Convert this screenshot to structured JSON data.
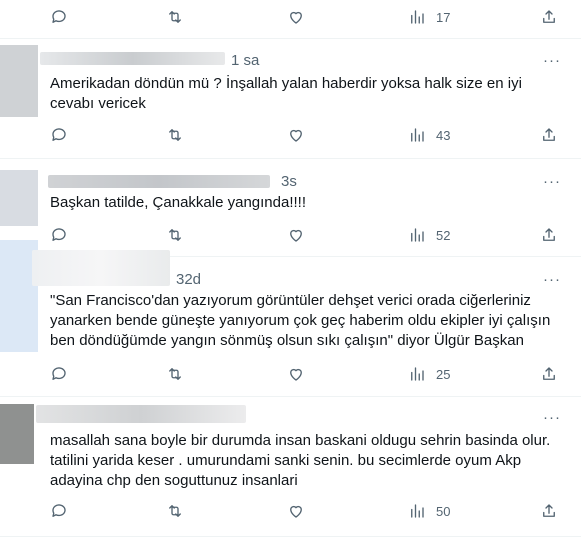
{
  "tweets": [
    {
      "time": "",
      "text": "",
      "views": "17"
    },
    {
      "time": "1 sa",
      "text": "Amerikadan döndün mü ? İnşallah yalan haberdir yoksa halk size en iyi\ncevabı vericek",
      "views": "43"
    },
    {
      "time": "3s",
      "text": "Başkan tatilde, Çanakkale yangında!!!!",
      "views": "52"
    },
    {
      "time": "32d",
      "text": "\"San Francisco'dan yazıyorum görüntüler dehşet verici orada ciğerleriniz\nyanarken bende güneşte yanıyorum çok geç haberim oldu ekipler iyi çalışın\nben döndüğümde yangın sönmüş olsun sıkı çalışın\" diyor Ülgür Başkan",
      "views": "25"
    },
    {
      "time": "",
      "text": "masallah sana boyle bir durumda insan baskani oldugu sehrin basinda olur.\ntatilini yarida keser . umurundami sanki senin. bu secimlerde oyum Akp\nadayina chp den soguttunuz insanlari",
      "views": "50"
    }
  ],
  "more_label": "···",
  "icons": [
    "reply-icon",
    "retweet-icon",
    "like-icon",
    "views-icon",
    "share-icon"
  ],
  "colors": {
    "text": "#0f1419",
    "muted": "#536471",
    "divider": "#eff3f4"
  }
}
